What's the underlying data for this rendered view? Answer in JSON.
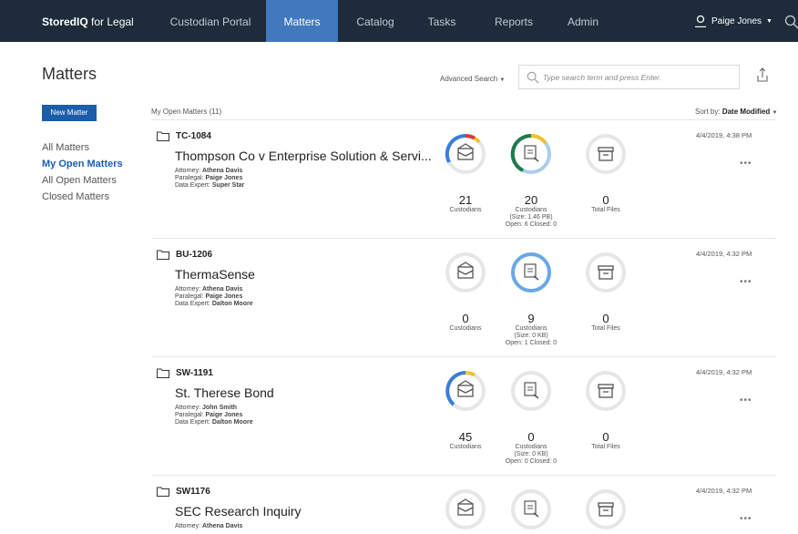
{
  "topnav": {
    "brand_bold": "StoredIQ",
    "brand_rest": " for Legal",
    "items": [
      {
        "label": "Custodian Portal"
      },
      {
        "label": "Matters"
      },
      {
        "label": "Catalog"
      },
      {
        "label": "Tasks"
      },
      {
        "label": "Reports"
      },
      {
        "label": "Admin"
      }
    ],
    "active_item": "Matters",
    "user": "Paige Jones",
    "icons": [
      "user-icon",
      "caret-down-icon",
      "search-icon"
    ]
  },
  "sidebar": {
    "title": "Matters",
    "new_button": "New Matter",
    "links": [
      {
        "label": "All Matters"
      },
      {
        "label": "My Open Matters"
      },
      {
        "label": "All Open Matters"
      },
      {
        "label": "Closed Matters"
      }
    ],
    "active_link": "My Open Matters"
  },
  "toolbar": {
    "advanced_search": "Advanced Search",
    "search_placeholder": "Type search term and press Enter.",
    "list_count": "My Open Matters (11)",
    "sort_label": "Sort by:",
    "sort_value": "Date Modified"
  },
  "colors": {
    "nav_bg": "#1d2b3a",
    "accent": "#4178be",
    "button": "#1c5dab",
    "ring_blue": "#3a7ed8",
    "ring_red": "#d63b2f",
    "ring_yellow": "#f2c22e",
    "ring_green": "#1f7a4a",
    "ring_track": "#e4e6e8"
  },
  "matters": [
    {
      "id": "TC-1084",
      "name": "Thompson Co v Enterprise Solution & Servi...",
      "attorney_label": "Attorney:",
      "attorney": "Athena Davis",
      "paralegal_label": "Paralegal:",
      "paralegal": "Paige Jones",
      "expert_label": "Data Expert:",
      "expert": "Super Star",
      "date": "4/4/2019, 4:38 PM",
      "notice": {
        "count": "21",
        "label": "Custodians"
      },
      "interview": {
        "count": "20",
        "label": "Custodians",
        "size": "(Size: 1.46 PB)",
        "open_closed": "Open: 6   Closed: 0"
      },
      "files": {
        "count": "0",
        "label": "Total Files"
      }
    },
    {
      "id": "BU-1206",
      "name": "ThermaSense",
      "attorney_label": "Attorney:",
      "attorney": "Athena Davis",
      "paralegal_label": "Paralegal:",
      "paralegal": "Paige Jones",
      "expert_label": "Data Expert:",
      "expert": "Dalton Moore",
      "date": "4/4/2019, 4:32 PM",
      "notice": {
        "count": "0",
        "label": "Custodians"
      },
      "interview": {
        "count": "9",
        "label": "Custodians",
        "size": "(Size: 0 KB)",
        "open_closed": "Open: 1   Closed: 0"
      },
      "files": {
        "count": "0",
        "label": "Total Files"
      }
    },
    {
      "id": "SW-1191",
      "name": "St. Therese Bond",
      "attorney_label": "Attorney:",
      "attorney": "John Smith",
      "paralegal_label": "Paralegal:",
      "paralegal": "Paige Jones",
      "expert_label": "Data Expert:",
      "expert": "Dalton Moore",
      "date": "4/4/2019, 4:32 PM",
      "notice": {
        "count": "45",
        "label": "Custodians"
      },
      "interview": {
        "count": "0",
        "label": "Custodians",
        "size": "(Size: 0 KB)",
        "open_closed": "Open: 0   Closed: 0"
      },
      "files": {
        "count": "0",
        "label": "Total Files"
      }
    },
    {
      "id": "SW1176",
      "name": "SEC Research Inquiry",
      "attorney_label": "Attorney:",
      "attorney": "Athena Davis",
      "date": "4/4/2019, 4:32 PM"
    }
  ]
}
